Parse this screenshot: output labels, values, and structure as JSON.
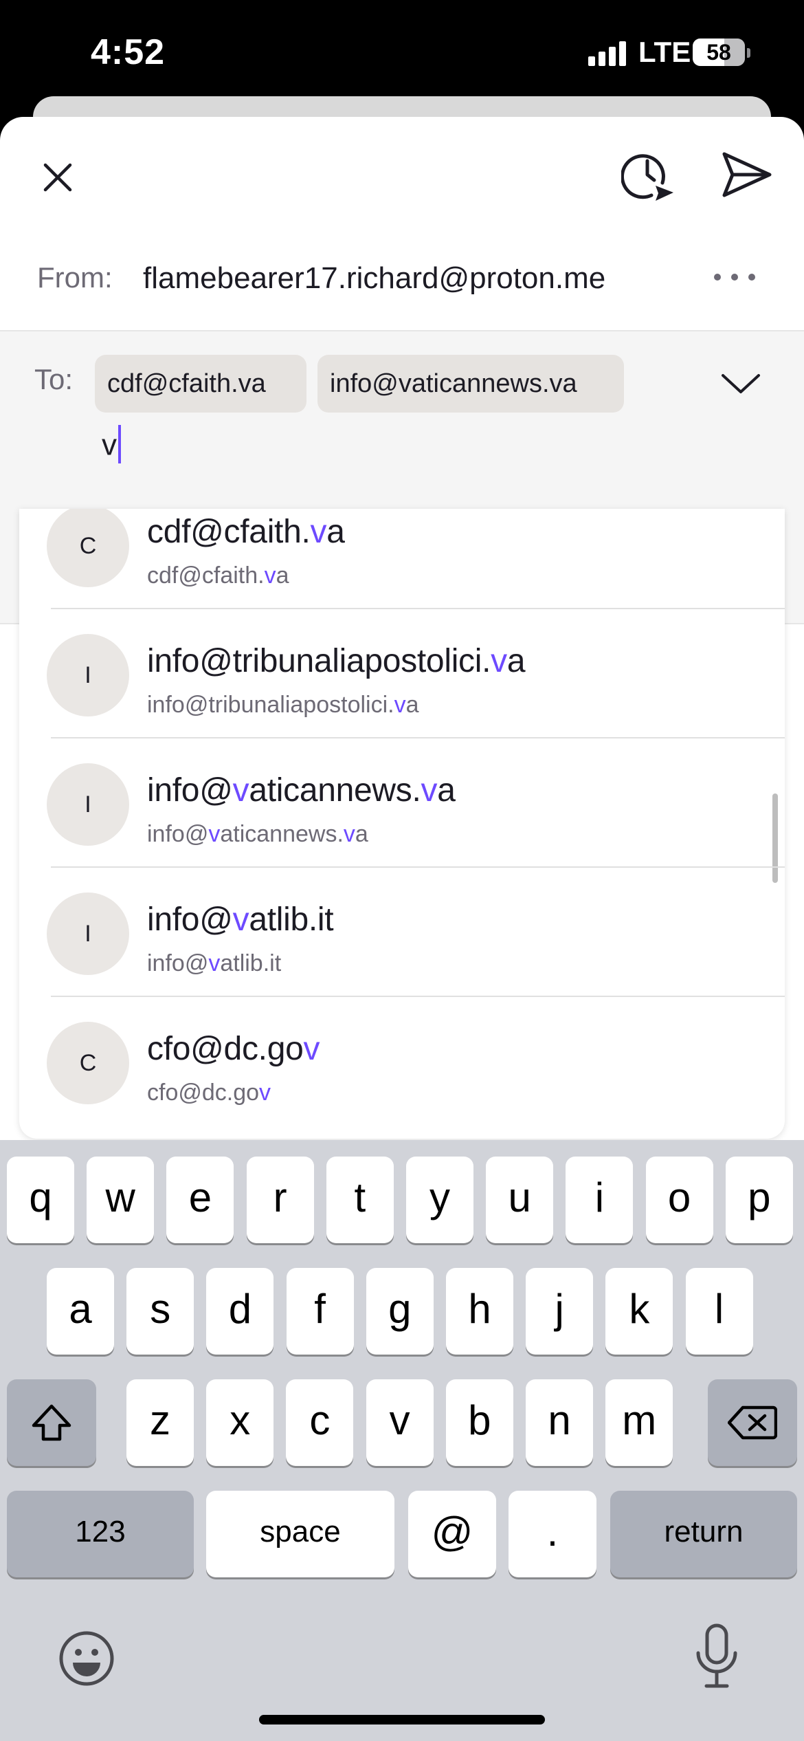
{
  "status_bar": {
    "time": "4:52",
    "network": "LTE",
    "battery": "58"
  },
  "compose": {
    "from_label": "From:",
    "from_address": "flamebearer17.richard@proton.me",
    "to_label": "To:",
    "recipients": [
      "cdf@cfaith.va",
      "info@vaticannews.va"
    ],
    "to_input_value": "v"
  },
  "suggestions": [
    {
      "initial": "C",
      "title_parts": [
        [
          "cdf@cfaith.",
          false
        ],
        [
          "v",
          true
        ],
        [
          "a",
          false
        ]
      ],
      "sub_parts": [
        [
          "cdf@cfaith.",
          false
        ],
        [
          "v",
          true
        ],
        [
          "a",
          false
        ]
      ]
    },
    {
      "initial": "I",
      "title_parts": [
        [
          "info@tribunaliapostolici.",
          false
        ],
        [
          "v",
          true
        ],
        [
          "a",
          false
        ]
      ],
      "sub_parts": [
        [
          "info@tribunaliapostolici.",
          false
        ],
        [
          "v",
          true
        ],
        [
          "a",
          false
        ]
      ]
    },
    {
      "initial": "I",
      "title_parts": [
        [
          "info@",
          false
        ],
        [
          "v",
          true
        ],
        [
          "aticannews.",
          false
        ],
        [
          "v",
          true
        ],
        [
          "a",
          false
        ]
      ],
      "sub_parts": [
        [
          "info@",
          false
        ],
        [
          "v",
          true
        ],
        [
          "aticannews.",
          false
        ],
        [
          "v",
          true
        ],
        [
          "a",
          false
        ]
      ]
    },
    {
      "initial": "I",
      "title_parts": [
        [
          "info@",
          false
        ],
        [
          "v",
          true
        ],
        [
          "atlib.it",
          false
        ]
      ],
      "sub_parts": [
        [
          "info@",
          false
        ],
        [
          "v",
          true
        ],
        [
          "atlib.it",
          false
        ]
      ]
    },
    {
      "initial": "C",
      "title_parts": [
        [
          "cfo@dc.go",
          false
        ],
        [
          "v",
          true
        ]
      ],
      "sub_parts": [
        [
          "cfo@dc.go",
          false
        ],
        [
          "v",
          true
        ]
      ]
    }
  ],
  "keyboard": {
    "row1": [
      "q",
      "w",
      "e",
      "r",
      "t",
      "y",
      "u",
      "i",
      "o",
      "p"
    ],
    "row2": [
      "a",
      "s",
      "d",
      "f",
      "g",
      "h",
      "j",
      "k",
      "l"
    ],
    "row3": [
      "z",
      "x",
      "c",
      "v",
      "b",
      "n",
      "m"
    ],
    "numbers_label": "123",
    "space_label": "space",
    "at_label": "@",
    "dot_label": ".",
    "return_label": "return"
  },
  "colors": {
    "accent": "#6d4aff",
    "keyboard_bg": "#d1d3d9",
    "chip_bg": "#e6e3e0"
  },
  "icons": [
    "close-icon",
    "schedule-send-icon",
    "send-icon",
    "more-icon",
    "chevron-down-icon",
    "shift-icon",
    "backspace-icon",
    "emoji-icon",
    "microphone-icon"
  ]
}
